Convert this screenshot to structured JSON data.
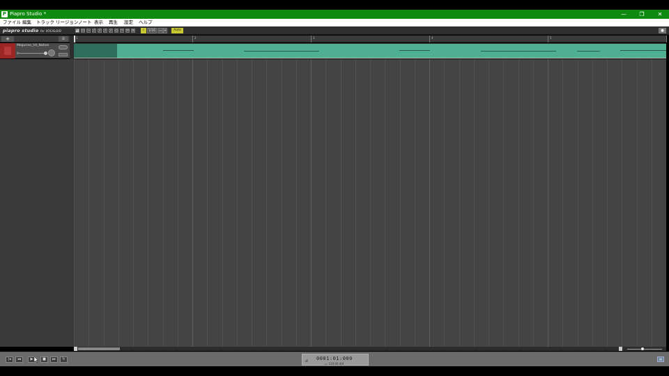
{
  "window": {
    "title": "Piapro Studio *",
    "app_icon": "P",
    "minimize": "—",
    "restore": "❐",
    "close": "✕"
  },
  "menu": [
    "ファイル",
    "編集",
    "トラック",
    "リージョン",
    "ノート",
    "表示",
    "再生",
    "設定",
    "ヘルプ"
  ],
  "toolbar": {
    "logo": "piapro studio",
    "logo_sub": "for VOCALOID",
    "quantize_value": "1/16",
    "snap_label": "Auto",
    "right_button": "●"
  },
  "tracks_header": {
    "add_button": "+",
    "menu_button": "☰"
  },
  "track": {
    "name": "Megurine_V4_Native",
    "color": "#9a2626",
    "vol_label": "0"
  },
  "ruler": {
    "bars": [
      "1",
      "2",
      "3",
      "4",
      "5",
      "6"
    ]
  },
  "transport": {
    "time": "0001:01:000",
    "sub": "♩= 120.00   4/4"
  }
}
